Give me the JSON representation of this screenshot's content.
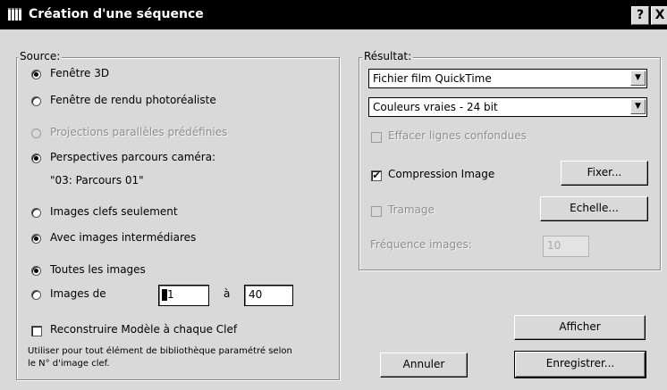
{
  "window": {
    "title": "Création d'une séquence",
    "help_label": "?",
    "close_label": "X"
  },
  "source": {
    "legend": "Source:",
    "window_3d": "Fenêtre 3D",
    "photo_window": "Fenêtre de rendu photoréaliste",
    "parallel_projections": "Projections parallèles prédéfinies",
    "camera_paths": "Perspectives parcours caméra:",
    "path_name": "\"03: Parcours 01\"",
    "keyframes_only": "Images clefs seulement",
    "with_intermediate": "Avec images intermédiares",
    "all_images": "Toutes les images",
    "images_from": "Images de",
    "from_value": "1",
    "to_label": "à",
    "to_value": "40",
    "rebuild_model": "Reconstruire Modèle à chaque Clef",
    "note_line1": "Utiliser pour tout élément de bibliothèque paramétré selon",
    "note_line2": "le N° d'image clef."
  },
  "result": {
    "legend": "Résultat:",
    "format_value": "Fichier film QuickTime",
    "color_value": "Couleurs vraies - 24 bit",
    "erase_lines": "Effacer lignes confondues",
    "compression": "Compression Image",
    "fix_button": "Fixer...",
    "dithering": "Tramage",
    "scale_button": "Echelle...",
    "frame_rate_label": "Fréquence images:",
    "frame_rate_value": "10"
  },
  "buttons": {
    "show": "Afficher",
    "cancel": "Annuler",
    "save": "Enregistrer..."
  },
  "state": {
    "source_selected": "Fenêtre 3D",
    "camera_selected": true,
    "sequence_selected": "Avec images intermédiares",
    "range_selected": "Toutes les images",
    "compression_checked": true
  }
}
